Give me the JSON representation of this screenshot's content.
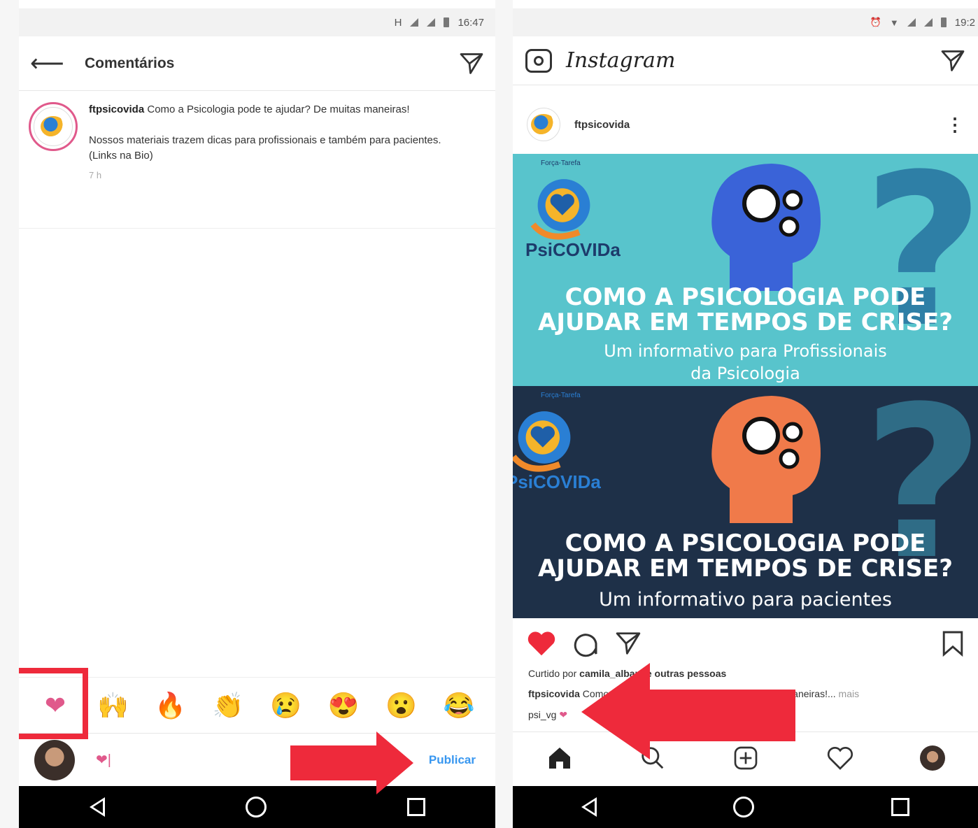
{
  "left": {
    "status": {
      "network": "H",
      "time": "16:47"
    },
    "header": {
      "title": "Comentários"
    },
    "caption": {
      "username": "ftpsicovida",
      "line1": "Como a Psicologia pode te ajudar? De muitas maneiras!",
      "line2": "Nossos materiais trazem dicas para profissionais e também para pacientes.",
      "line3": "(Links na Bio)",
      "time": "7 h"
    },
    "emojis": [
      "❤",
      "🙌",
      "🔥",
      "👏",
      "😢",
      "😍",
      "😮",
      "😂"
    ],
    "comment": {
      "typed": "❤|",
      "publish_label": "Publicar"
    }
  },
  "right": {
    "status": {
      "time": "19:2"
    },
    "header": {
      "brand": "Instagram"
    },
    "post": {
      "username": "ftpsicovida"
    },
    "panel1": {
      "small": "Força-Tarefa",
      "brand": "PsiCOVIDa",
      "title1": "COMO A PSICOLOGIA PODE",
      "title2": "AJUDAR EM TEMPOS DE CRISE?",
      "sub1": "Um informativo para Profissionais",
      "sub2": "da Psicologia"
    },
    "panel2": {
      "small": "Força-Tarefa",
      "brand": "PsiCOVIDa",
      "title1": "COMO A PSICOLOGIA PODE",
      "title2": "AJUDAR EM TEMPOS DE CRISE?",
      "sub1": "Um informativo para pacientes"
    },
    "liked_prefix": "Curtido por ",
    "liked_user": "camila_albani",
    "liked_suffix": " e outras pessoas",
    "caption_user": "ftpsicovida",
    "caption_text": " Como a Psicologia pode te ajudar? De muitas maneiras!...",
    "caption_more": " mais",
    "comment_user": "psi_vg",
    "comment_text": " ❤"
  },
  "colors": {
    "highlight": "#ee2a3b",
    "heart": "#e0598b",
    "panel1": "#58c4cc",
    "panel2": "#1e3048",
    "link": "#3897f0"
  }
}
